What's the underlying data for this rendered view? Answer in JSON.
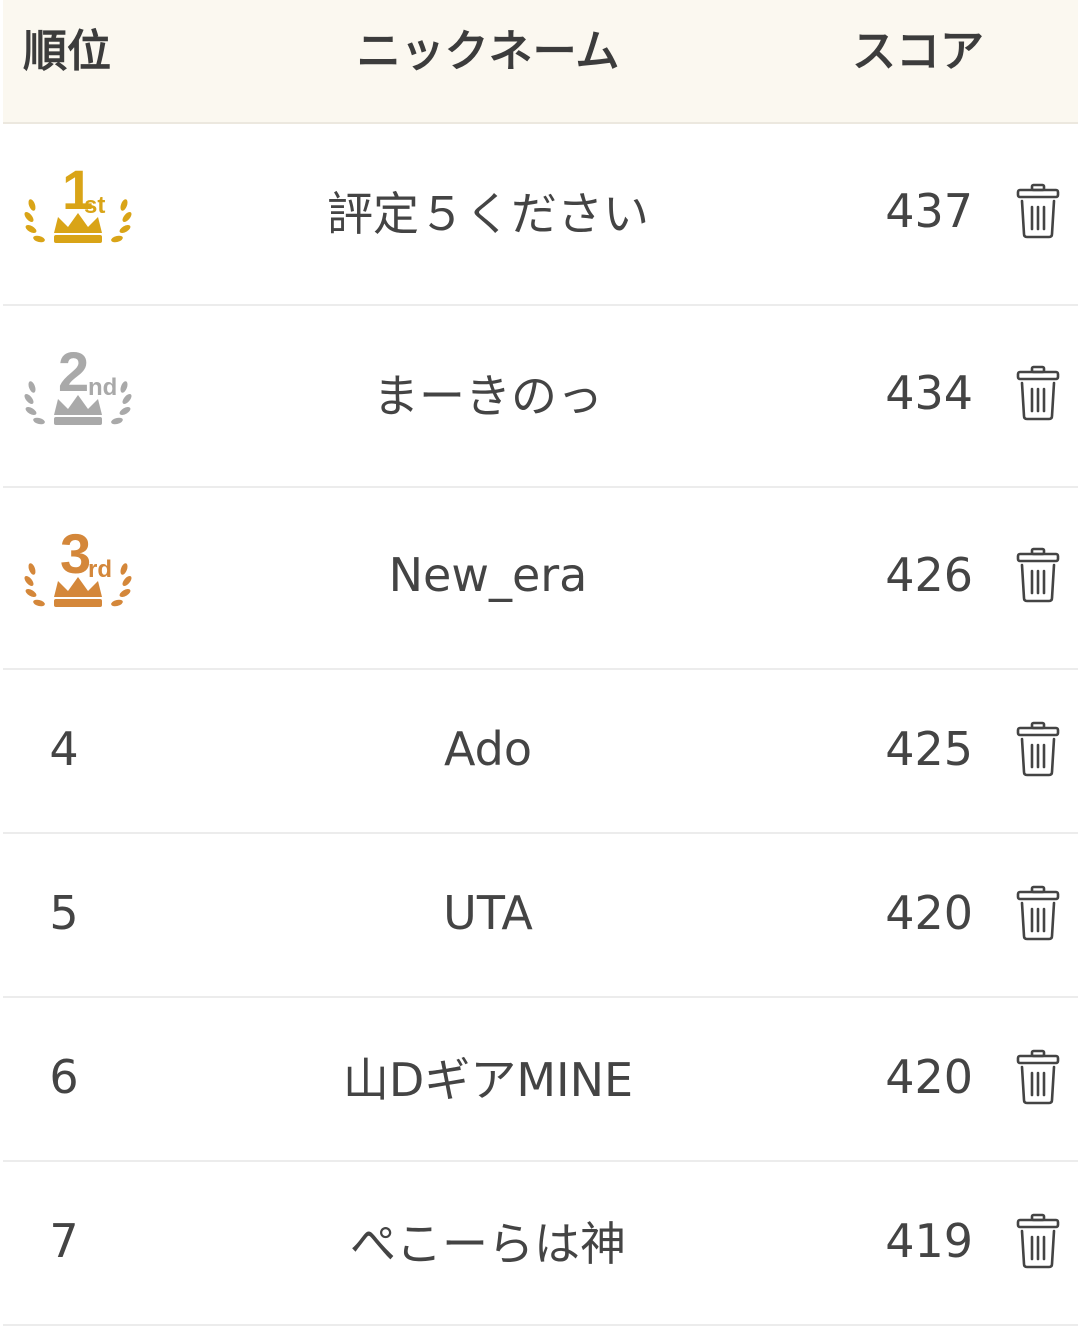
{
  "header": {
    "rank": "順位",
    "name": "ニックネーム",
    "score": "スコア"
  },
  "colors": {
    "gold": "#d9a417",
    "silver": "#a9a9a9",
    "bronze": "#d4873a",
    "header_bg": "#fbf8f0"
  },
  "rows": [
    {
      "rank": "1",
      "badge": "1st",
      "badge_icon": "gold-crown-laurel-icon",
      "name": "評定５ください",
      "score": "437"
    },
    {
      "rank": "2",
      "badge": "2nd",
      "badge_icon": "silver-crown-laurel-icon",
      "name": "まーきのっ",
      "score": "434"
    },
    {
      "rank": "3",
      "badge": "3rd",
      "badge_icon": "bronze-crown-laurel-icon",
      "name": "New_era",
      "score": "426"
    },
    {
      "rank": "4",
      "name": "Ado",
      "score": "425"
    },
    {
      "rank": "5",
      "name": "UTA",
      "score": "420"
    },
    {
      "rank": "6",
      "name": "山DギアMINE",
      "score": "420"
    },
    {
      "rank": "7",
      "name": "ぺこーらは神",
      "score": "419"
    }
  ],
  "delete_icon": "trash-icon"
}
